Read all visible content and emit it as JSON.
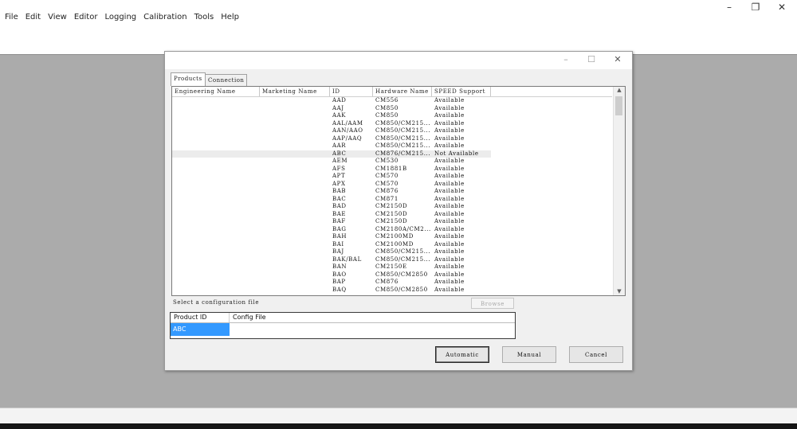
{
  "menu": [
    "File",
    "Edit",
    "View",
    "Editor",
    "Logging",
    "Calibration",
    "Tools",
    "Help"
  ],
  "window_controls": {
    "minimize": "–",
    "maximize": "❐",
    "close": "✕"
  },
  "dialog": {
    "controls": {
      "minimize": "–",
      "maximize": "☐",
      "close": "✕"
    },
    "tabs": [
      "Products",
      "Connection"
    ],
    "columns": [
      "Engineering Name",
      "Marketing Name",
      "ID",
      "Hardware Name",
      "SPEED Support"
    ],
    "rows": [
      {
        "id": "AAD",
        "hw": "CM556",
        "speed": "Available"
      },
      {
        "id": "AAJ",
        "hw": "CM850",
        "speed": "Available"
      },
      {
        "id": "AAK",
        "hw": "CM850",
        "speed": "Available"
      },
      {
        "id": "AAL/AAM",
        "hw": "CM850/CM215...",
        "speed": "Available"
      },
      {
        "id": "AAN/AAO",
        "hw": "CM850/CM215...",
        "speed": "Available"
      },
      {
        "id": "AAP/AAQ",
        "hw": "CM850/CM215...",
        "speed": "Available"
      },
      {
        "id": "AAR",
        "hw": "CM850/CM215...",
        "speed": "Available"
      },
      {
        "id": "ABC",
        "hw": "CM876/CM215...",
        "speed": "Not Available"
      },
      {
        "id": "AEM",
        "hw": "CM530",
        "speed": "Available"
      },
      {
        "id": "AFS",
        "hw": "CM1881B",
        "speed": "Available"
      },
      {
        "id": "APT",
        "hw": "CM570",
        "speed": "Available"
      },
      {
        "id": "APX",
        "hw": "CM570",
        "speed": "Available"
      },
      {
        "id": "BAB",
        "hw": "CM876",
        "speed": "Available"
      },
      {
        "id": "BAC",
        "hw": "CM871",
        "speed": "Available"
      },
      {
        "id": "BAD",
        "hw": "CM2150D",
        "speed": "Available"
      },
      {
        "id": "BAE",
        "hw": "CM2150D",
        "speed": "Available"
      },
      {
        "id": "BAF",
        "hw": "CM2150D",
        "speed": "Available"
      },
      {
        "id": "BAG",
        "hw": "CM2180A/CM2...",
        "speed": "Available"
      },
      {
        "id": "BAH",
        "hw": "CM2100MD",
        "speed": "Available"
      },
      {
        "id": "BAI",
        "hw": "CM2100MD",
        "speed": "Available"
      },
      {
        "id": "BAJ",
        "hw": "CM850/CM215...",
        "speed": "Available"
      },
      {
        "id": "BAK/BAL",
        "hw": "CM850/CM215...",
        "speed": "Available"
      },
      {
        "id": "BAN",
        "hw": "CM2150E",
        "speed": "Available"
      },
      {
        "id": "BAO",
        "hw": "CM850/CM2850",
        "speed": "Available"
      },
      {
        "id": "BAP",
        "hw": "CM876",
        "speed": "Available"
      },
      {
        "id": "BAQ",
        "hw": "CM850/CM2850",
        "speed": "Available"
      }
    ],
    "selected_row": "ABC",
    "config_label": "Select a configuration file",
    "browse_label": "Browse",
    "config_table": {
      "headers": [
        "Product ID",
        "Config File"
      ],
      "row": {
        "product_id": "ABC",
        "config_file": ""
      }
    },
    "buttons": {
      "automatic": "Automatic",
      "manual": "Manual",
      "cancel": "Cancel"
    }
  }
}
